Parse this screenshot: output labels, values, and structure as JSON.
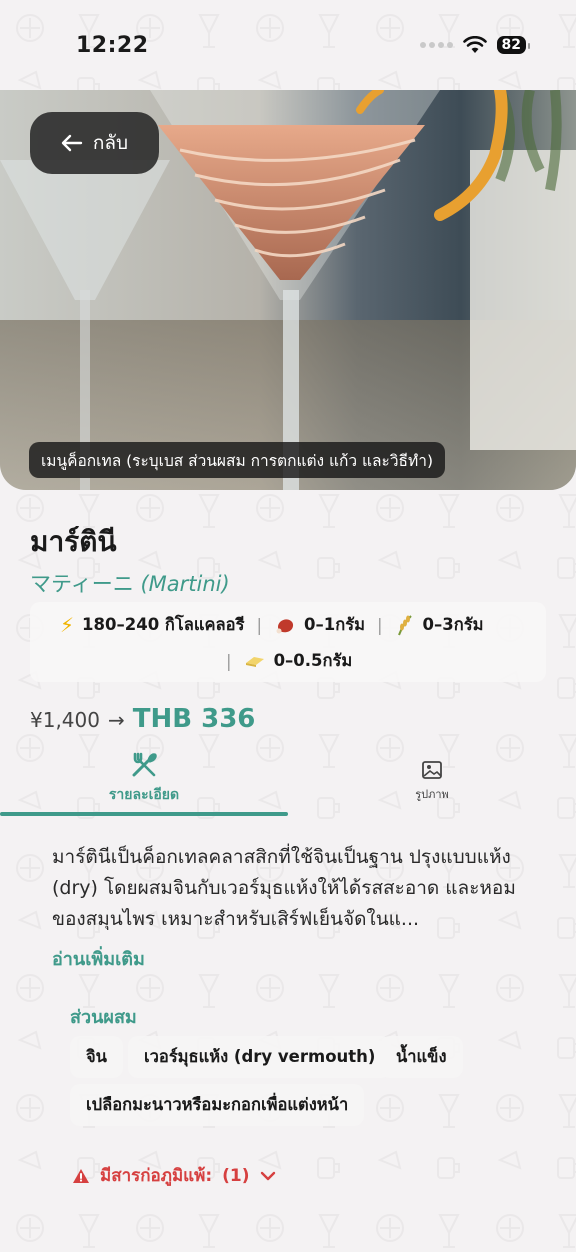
{
  "status_bar": {
    "time": "12:22",
    "battery": "82"
  },
  "header": {
    "back_label": "กลับ"
  },
  "hero": {
    "caption": "เมนูค็อกเทล (ระบุเบส ส่วนผสม การตกแต่ง แก้ว และวิธีทำ)"
  },
  "dish": {
    "title": "มาร์ตินี",
    "subtitle_jp": "マティーニ",
    "subtitle_en": "(Martini)"
  },
  "nutrition": {
    "calories": "180–240 กิโลแคลอรี",
    "protein": "0–1กรัม",
    "carbs": "0–3กรัม",
    "fat": "0–0.5กรัม"
  },
  "price": {
    "original": "¥1,400",
    "arrow": "→",
    "converted": "THB 336"
  },
  "tabs": {
    "details": "รายละเอียด",
    "photos": "รูปภาพ"
  },
  "description": {
    "text": "มาร์ตินีเป็นค็อกเทลคลาสสิกที่ใช้จินเป็นฐาน ปรุงแบบแห้ง (dry) โดยผสมจินกับเวอร์มุธแห้งให้ได้รสสะอาด และหอมของสมุนไพร เหมาะสำหรับเสิร์ฟเย็นจัดในแ...",
    "read_more": "อ่านเพิ่มเติม"
  },
  "ingredients": {
    "title": "ส่วนผสม",
    "items": [
      "จิน",
      "เวอร์มุธแห้ง (dry vermouth)",
      "น้ำแข็ง",
      "เปลือกมะนาวหรือมะกอกเพื่อแต่งหน้า"
    ]
  },
  "allergy": {
    "label": "มีสารก่อภูมิแพ้:",
    "count": "(1)"
  },
  "colors": {
    "accent": "#3f9a8a",
    "warning": "#d64040"
  }
}
